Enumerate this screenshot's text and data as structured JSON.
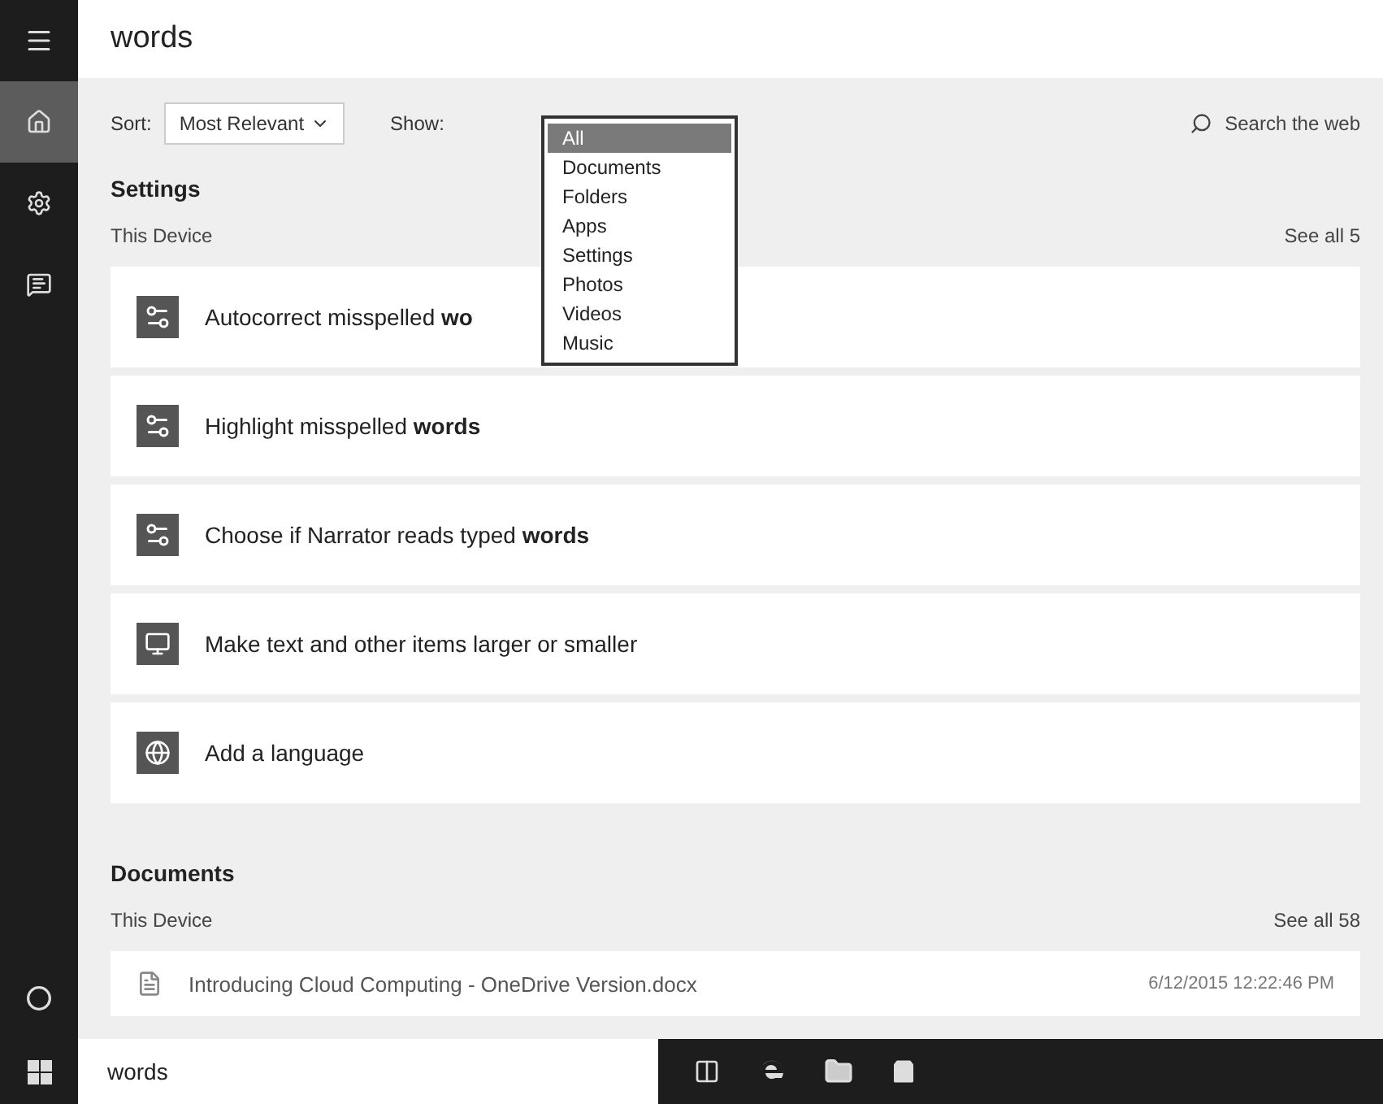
{
  "search": {
    "value": "words"
  },
  "sidebar": {
    "items": [
      {
        "kind": "home",
        "selected": true
      },
      {
        "kind": "settings",
        "selected": false
      },
      {
        "kind": "feedback",
        "selected": false
      }
    ]
  },
  "filters": {
    "sort_label": "Sort:",
    "sort_value": "Most Relevant",
    "show_label": "Show:",
    "show_options": [
      {
        "label": "All",
        "selected": true
      },
      {
        "label": "Documents",
        "selected": false
      },
      {
        "label": "Folders",
        "selected": false
      },
      {
        "label": "Apps",
        "selected": false
      },
      {
        "label": "Settings",
        "selected": false
      },
      {
        "label": "Photos",
        "selected": false
      },
      {
        "label": "Videos",
        "selected": false
      },
      {
        "label": "Music",
        "selected": false
      }
    ]
  },
  "web_search": "Search the web",
  "sections": [
    {
      "title": "Settings",
      "scope": "This Device",
      "see_all": "See all 5",
      "results": [
        {
          "kind": "setting",
          "text": "Autocorrect misspelled **wo**"
        },
        {
          "kind": "setting",
          "text": "Highlight misspelled **words**"
        },
        {
          "kind": "setting",
          "text": "Choose if Narrator reads typed **words**"
        },
        {
          "kind": "display",
          "text": "Make text and other items larger or smaller"
        },
        {
          "kind": "language",
          "text": "Add a language"
        }
      ]
    },
    {
      "title": "Documents",
      "scope": "This Device",
      "see_all": "See all 58",
      "results": [
        {
          "kind": "document",
          "text": "Introducing Cloud Computing - OneDrive Version.docx",
          "date": "6/12/2015 12:22:46 PM"
        }
      ]
    }
  ],
  "taskbar": {
    "search_value": "words"
  }
}
